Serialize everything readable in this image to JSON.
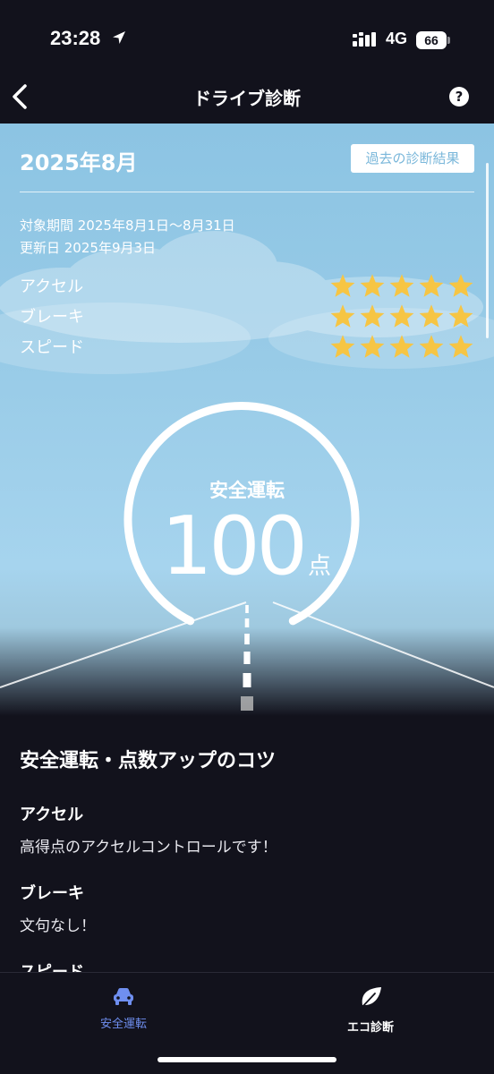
{
  "status_bar": {
    "time": "23:28",
    "network": "4G",
    "battery": "66"
  },
  "nav": {
    "title": "ドライブ診断",
    "help": "?"
  },
  "summary": {
    "month": "2025年8月",
    "past_results_label": "過去の診断結果",
    "period": "対象期間 2025年8月1日〜8月31日",
    "updated": "更新日 2025年9月3日",
    "ratings": [
      {
        "label": "アクセル",
        "stars": 5,
        "max": 5
      },
      {
        "label": "ブレーキ",
        "stars": 5,
        "max": 5
      },
      {
        "label": "スピード",
        "stars": 5,
        "max": 5
      }
    ],
    "gauge": {
      "label": "安全運転",
      "score": "100",
      "unit": "点",
      "fraction": 1.0
    }
  },
  "tips": {
    "title": "安全運転・点数アップのコツ",
    "items": [
      {
        "heading": "アクセル",
        "text": "高得点のアクセルコントロールです！"
      },
      {
        "heading": "ブレーキ",
        "text": "文句なし！"
      },
      {
        "heading": "スピード",
        "text": ""
      }
    ]
  },
  "tab_bar": {
    "tabs": [
      {
        "label": "安全運転",
        "icon": "car-icon",
        "active": true
      },
      {
        "label": "エコ診断",
        "icon": "leaf-icon",
        "active": false
      }
    ]
  },
  "colors": {
    "star": "#f6c544",
    "active_tab": "#6f8ff0",
    "background": "#12121c",
    "sky": "#98cbe7"
  }
}
